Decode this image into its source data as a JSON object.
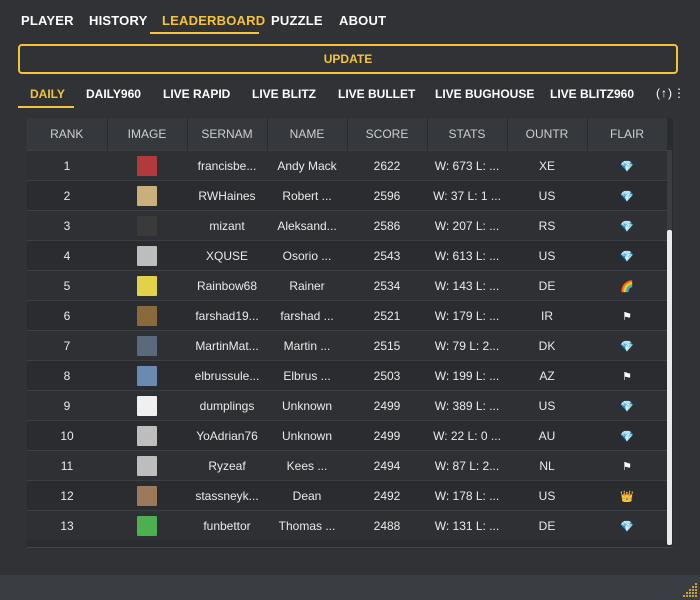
{
  "nav": {
    "tabs": [
      "PLAYER",
      "HISTORY",
      "LEADERBOARD",
      "PUZZLE",
      "ABOUT"
    ],
    "active": "LEADERBOARD"
  },
  "update_label": "UPDATE",
  "subtabs": {
    "items": [
      "DAILY",
      "DAILY960",
      "LIVE RAPID",
      "LIVE BLITZ",
      "LIVE BULLET",
      "LIVE BUGHOUSE",
      "LIVE BLITZ960"
    ],
    "active": "DAILY",
    "more_glyph": "(↑)⋮"
  },
  "table": {
    "headers": [
      "RANK",
      "IMAGE",
      "SERNAM",
      "NAME",
      "SCORE",
      "STATS",
      "OUNTR",
      "FLAIR"
    ],
    "rows": [
      {
        "rank": "1",
        "username": "francisbe...",
        "name": "Andy Mack",
        "score": "2622",
        "stats": "W: 673 L: ...",
        "country": "XE",
        "flair": "💎",
        "flair_kind": "diamond",
        "avatar": "#b23a3a"
      },
      {
        "rank": "2",
        "username": "RWHaines",
        "name": "Robert ...",
        "score": "2596",
        "stats": "W: 37 L: 1 ...",
        "country": "US",
        "flair": "💎",
        "flair_kind": "diamond",
        "avatar": "#c9b07a"
      },
      {
        "rank": "3",
        "username": "mizant",
        "name": "Aleksand...",
        "score": "2586",
        "stats": "W: 207 L: ...",
        "country": "RS",
        "flair": "💎",
        "flair_kind": "diamond",
        "avatar": "#3a3a3a"
      },
      {
        "rank": "4",
        "username": "XQUSE",
        "name": "Osorio ...",
        "score": "2543",
        "stats": "W: 613 L: ...",
        "country": "US",
        "flair": "💎",
        "flair_kind": "diamond",
        "avatar": "#bdbdbd"
      },
      {
        "rank": "5",
        "username": "Rainbow68",
        "name": "Rainer",
        "score": "2534",
        "stats": "W: 143 L: ...",
        "country": "DE",
        "flair": "🌈",
        "flair_kind": "rainbow",
        "avatar": "#e2d24a"
      },
      {
        "rank": "6",
        "username": "farshad19...",
        "name": "farshad ...",
        "score": "2521",
        "stats": "W: 179 L: ...",
        "country": "IR",
        "flair": "⚑",
        "flair_kind": "flag",
        "avatar": "#8a6a3a"
      },
      {
        "rank": "7",
        "username": "MartinMat...",
        "name": "Martin ...",
        "score": "2515",
        "stats": "W: 79 L: 2...",
        "country": "DK",
        "flair": "💎",
        "flair_kind": "diamond",
        "avatar": "#5a6a7a"
      },
      {
        "rank": "8",
        "username": "elbrussule...",
        "name": "Elbrus ...",
        "score": "2503",
        "stats": "W: 199 L: ...",
        "country": "AZ",
        "flair": "⚑",
        "flair_kind": "flag",
        "avatar": "#6a8ab0"
      },
      {
        "rank": "9",
        "username": "dumplings",
        "name": "Unknown",
        "score": "2499",
        "stats": "W: 389 L: ...",
        "country": "US",
        "flair": "💎",
        "flair_kind": "diamond",
        "avatar": "#f0f0f0"
      },
      {
        "rank": "10",
        "username": "YoAdrian76",
        "name": "Unknown",
        "score": "2499",
        "stats": "W: 22 L: 0 ...",
        "country": "AU",
        "flair": "💎",
        "flair_kind": "diamond",
        "avatar": "#bdbdbd"
      },
      {
        "rank": "11",
        "username": "Ryzeaf",
        "name": "Kees ...",
        "score": "2494",
        "stats": "W: 87 L: 2...",
        "country": "NL",
        "flair": "⚑",
        "flair_kind": "flag",
        "avatar": "#bdbdbd"
      },
      {
        "rank": "12",
        "username": "stassneyk...",
        "name": "Dean",
        "score": "2492",
        "stats": "W: 178 L: ...",
        "country": "US",
        "flair": "👑",
        "flair_kind": "crown",
        "avatar": "#9a7a5a"
      },
      {
        "rank": "13",
        "username": "funbettor",
        "name": "Thomas ...",
        "score": "2488",
        "stats": "W: 131 L: ...",
        "country": "DE",
        "flair": "💎",
        "flair_kind": "diamond",
        "avatar": "#4caf50"
      }
    ]
  },
  "icons": {
    "diamond": "diamond-icon",
    "flag": "flag-icon",
    "rainbow": "rainbow-icon",
    "crown": "crown-icon",
    "resize": "resize-grip-icon"
  },
  "colors": {
    "accent": "#f3c43a",
    "background": "#303236",
    "table_bg": "#2a2c30"
  }
}
